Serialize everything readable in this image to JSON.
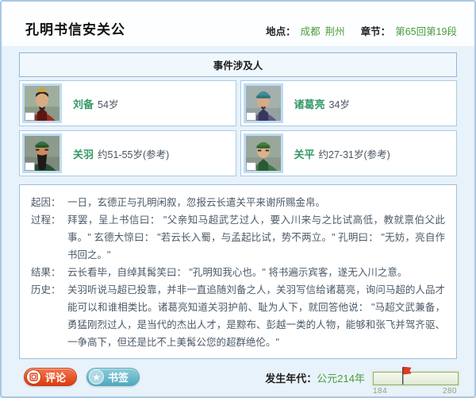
{
  "header": {
    "title": "孔明书信安关公",
    "location_label": "地点：",
    "locations": [
      "成都",
      "荆州"
    ],
    "chapter_label": "章节：",
    "chapter_value": "第65回第19段"
  },
  "people_panel": {
    "title": "事件涉及人",
    "people": [
      {
        "name": "刘备",
        "age": "54岁",
        "portrait_icon": "liubei-portrait"
      },
      {
        "name": "诸葛亮",
        "age": "34岁",
        "portrait_icon": "zhugeliang-portrait"
      },
      {
        "name": "关羽",
        "age": "约51-55岁(参考)",
        "portrait_icon": "guanyu-portrait"
      },
      {
        "name": "关平",
        "age": "约27-31岁(参考)",
        "portrait_icon": "guanping-portrait"
      }
    ]
  },
  "event_detail": {
    "sections": [
      {
        "label": "起因：",
        "text": "一日，玄德正与孔明闲叙，忽报云长遣关平来谢所赐金帛。"
      },
      {
        "label": "过程：",
        "text": "拜罢，呈上书信曰： \"父亲知马超武艺过人，要入川来与之比试高低，教就禀伯父此事。\" 玄德大惊曰： \"若云长入蜀，与孟起比试，势不两立。\" 孔明曰： \"无妨，亮自作书回之。\""
      },
      {
        "label": "结果：",
        "text": "云长看毕，自绰其髯笑曰： \"孔明知我心也。\" 将书遍示宾客，遂无入川之意。"
      },
      {
        "label": "历史：",
        "text": "关羽听说马超已投靠，并非一直追随刘备之人，关羽写信给诸葛亮，询问马超的人品才能可以和谁相类比。诸葛亮知道关羽护前、耻为人下，就回答他说： \"马超文武兼备，勇猛刚烈过人，是当代的杰出人才，是黥布、彭越一类的人物，能够和张飞并驾齐驱、一争高下，但还是比不上美髯公您的超群绝伦。\""
      }
    ]
  },
  "footer": {
    "comment_label": "评论",
    "bookmark_label": "书签",
    "bookmark_star_glyph": "★",
    "year_label": "发生年代：",
    "year_value": "公元214年",
    "timeline": {
      "min": "184",
      "max": "280",
      "current_year": 214,
      "flag_percent": 31.25
    }
  },
  "colors": {
    "link_green": "#4a9c3c",
    "name_green": "#339966",
    "comment_red": "#dd3c10",
    "bookmark_teal": "#54abbe",
    "flag_red": "#e23b1f",
    "panel_border_blue": "#9cc0e0",
    "page_background": "#e8f2fa"
  }
}
